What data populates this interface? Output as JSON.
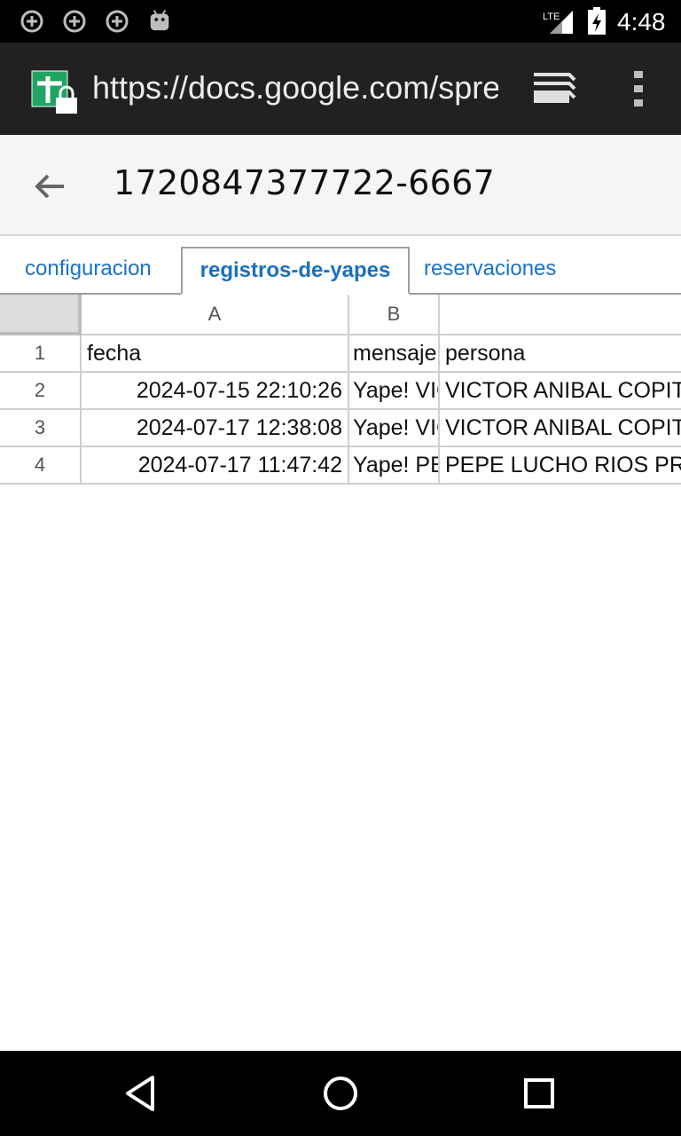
{
  "status_bar": {
    "time": "4:48",
    "network": "LTE",
    "icons": [
      "add-circle-icon",
      "add-circle-icon",
      "add-circle-icon",
      "android-icon",
      "signal-icon",
      "battery-charging-icon"
    ]
  },
  "browser": {
    "url": "https://docs.google.com/spreadsheets",
    "site_icon": "sheets-lock-icon",
    "tabs_icon": "tabs-icon",
    "menu_icon": "more-vert-icon"
  },
  "header": {
    "title": "1720847377722-6667",
    "back_icon": "arrow-back-icon"
  },
  "sheet_tabs": [
    {
      "label": "configuracion",
      "active": false
    },
    {
      "label": "registros-de-yapes",
      "active": true
    },
    {
      "label": "reservaciones",
      "active": false
    }
  ],
  "grid": {
    "columns": [
      "A",
      "B",
      ""
    ],
    "rows": [
      {
        "num": "1",
        "a": "fecha",
        "b": "mensaje",
        "c": "persona"
      },
      {
        "num": "2",
        "a": "2024-07-15 22:10:26",
        "b": "Yape! VICTOR",
        "c": "VICTOR ANIBAL COPITAN"
      },
      {
        "num": "3",
        "a": "2024-07-17 12:38:08",
        "b": "Yape! VICTOR",
        "c": "VICTOR ANIBAL COPITAN"
      },
      {
        "num": "4",
        "a": "2024-07-17 11:47:42",
        "b": "Yape! PEPE",
        "c": "PEPE LUCHO RIOS PRUNA"
      }
    ]
  },
  "colors": {
    "status_bar": "#000000",
    "url_bar": "#212121",
    "title_bar": "#f5f5f5",
    "tab_link": "#1a73c8",
    "sheets_green": "#1fa463"
  }
}
